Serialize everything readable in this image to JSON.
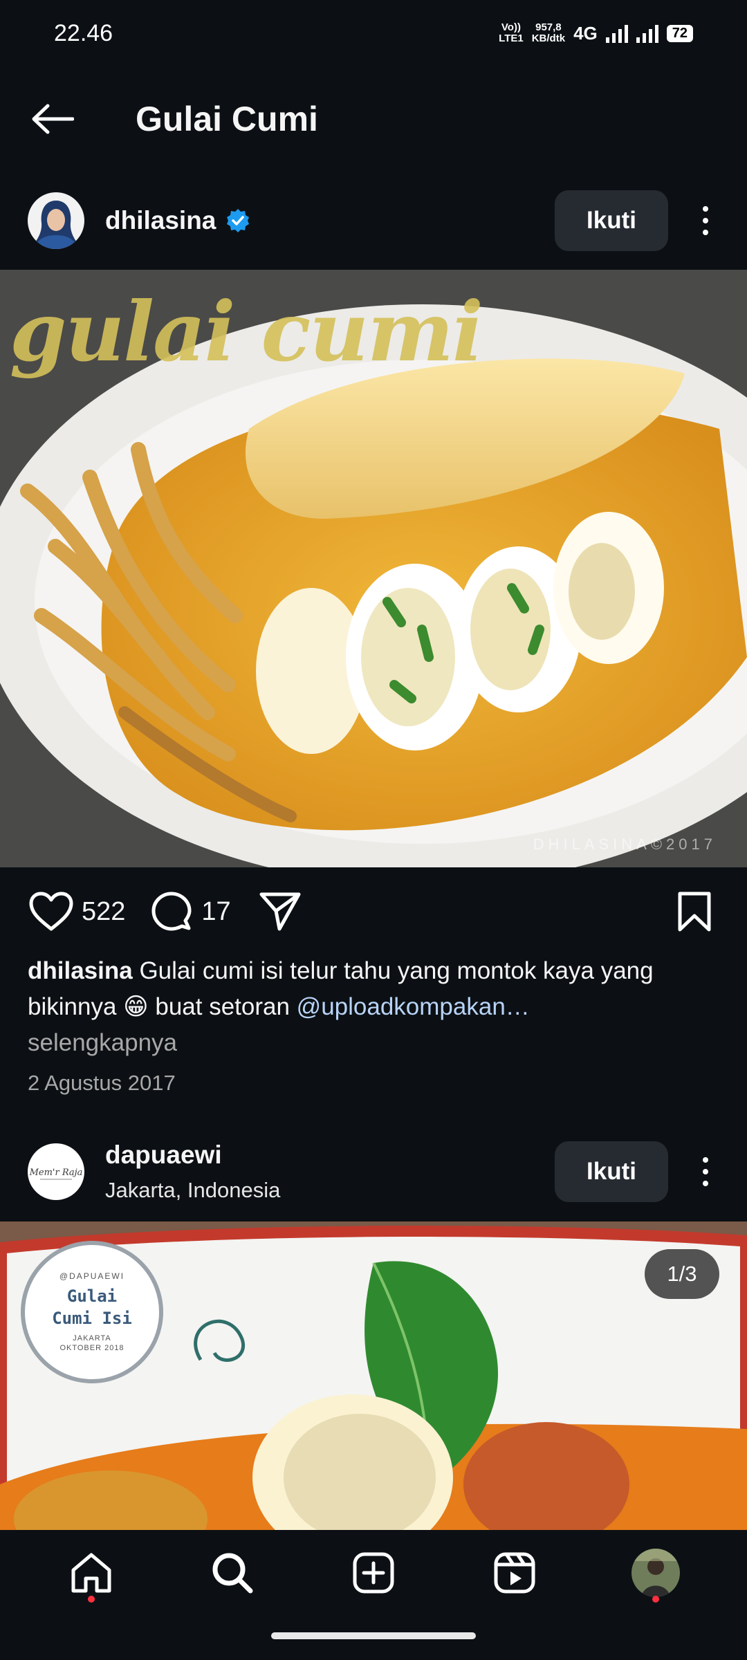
{
  "status_bar": {
    "time": "22.46",
    "volte_line1": "Vo))",
    "volte_line2": "LTE1",
    "speed_value": "957,8",
    "speed_unit": "KB/dtk",
    "network": "4G",
    "battery": "72"
  },
  "header": {
    "title": "Gulai Cumi"
  },
  "post1": {
    "username": "dhilasina",
    "verified": true,
    "follow_label": "Ikuti",
    "image_overlay_text": "gulai cumi",
    "image_watermark": "DHILASINA©2017",
    "likes": "522",
    "comments": "17",
    "caption_user": "dhilasina",
    "caption_text": "Gulai cumi isi telur tahu yang montok kaya yang bikinnya 😁 buat setoran",
    "caption_mention": "@uploadkompakan…",
    "more_label": "selengkapnya",
    "date": "2 Agustus 2017"
  },
  "post2": {
    "username": "dapuaewi",
    "location": "Jakarta, Indonesia",
    "follow_label": "Ikuti",
    "counter": "1/3",
    "stamp_handle": "@DAPUAEWI",
    "stamp_title_line1": "Gulai",
    "stamp_title_line2": "Cumi Isi",
    "stamp_place_line1": "JAKARTA",
    "stamp_place_line2": "OKTOBER 2018"
  },
  "bottom_nav": {
    "items": [
      "home",
      "search",
      "create",
      "reels",
      "profile"
    ]
  },
  "colors": {
    "background": "#0c1014",
    "button": "#262b31",
    "mention": "#b8d3f7",
    "verified": "#1d9bf0",
    "notification_dot": "#ff3040"
  }
}
